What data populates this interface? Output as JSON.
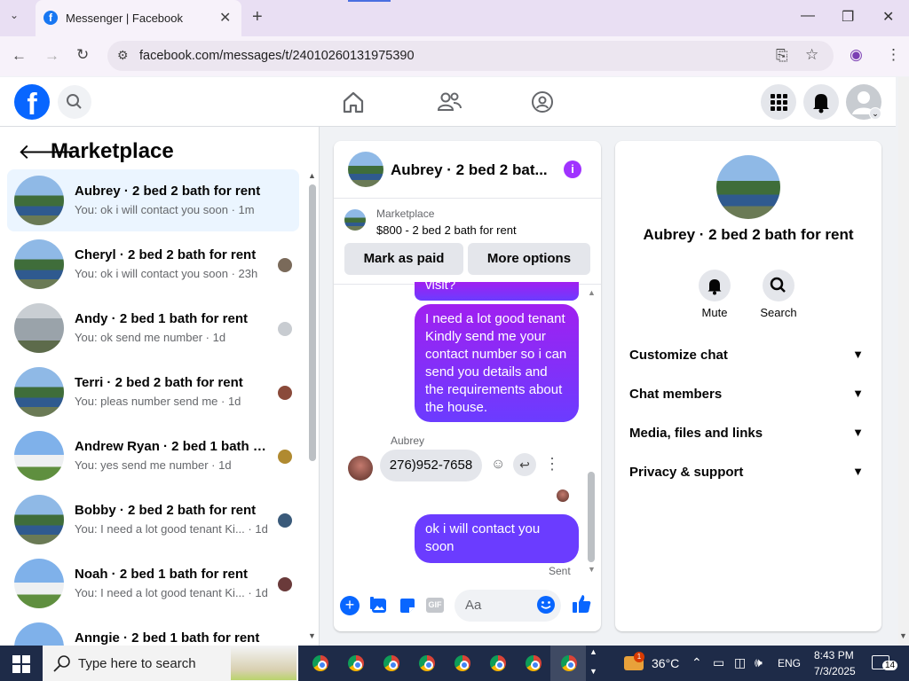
{
  "browser": {
    "tab_title": "Messenger | Facebook",
    "url": "facebook.com/messages/t/24010260131975390"
  },
  "left": {
    "title": "Marketplace",
    "conversations": [
      {
        "name": "Aubrey · 2 bed 2 bath for rent",
        "preview": "You: ok i will contact you soon · 1m"
      },
      {
        "name": "Cheryl · 2 bed 2 bath for rent",
        "preview": "You: ok i will contact you soon · 23h"
      },
      {
        "name": "Andy · 2 bed 1 bath for rent",
        "preview": "You: ok send me number · 1d"
      },
      {
        "name": "Terri · 2 bed 2 bath for rent",
        "preview": "You: pleas number send me · 1d"
      },
      {
        "name": "Andrew Ryan · 2 bed 1 bath fo...",
        "preview": "You: yes send me number · 1d"
      },
      {
        "name": "Bobby · 2 bed 2 bath for rent",
        "preview": "You: I need a lot good tenant Ki...  · 1d"
      },
      {
        "name": "Noah · 2 bed 1 bath for rent",
        "preview": "You: I need a lot good tenant Ki...  · 1d"
      },
      {
        "name": "Anngie · 2 bed 1 bath for rent",
        "preview": ""
      }
    ]
  },
  "chat": {
    "title": "Aubrey · 2 bed 2 bat...",
    "marketplace_label": "Marketplace",
    "listing": "$800 - 2 bed 2 bath for rent",
    "mark_paid": "Mark as paid",
    "more_options": "More options",
    "partial_msg": "visit?",
    "msg1": "I need a lot good tenant Kindly send me your contact number so i can send you details and the requirements about the house.",
    "other_name": "Aubrey",
    "other_msg": "276)952-7658",
    "msg2": "ok i will contact you soon",
    "status": "Sent",
    "composer_placeholder": "Aa"
  },
  "right": {
    "name": "Aubrey · 2 bed 2 bath for rent",
    "mute": "Mute",
    "search": "Search",
    "sections": [
      "Customize chat",
      "Chat members",
      "Media, files and links",
      "Privacy & support"
    ]
  },
  "taskbar": {
    "search_placeholder": "Type here to search",
    "temperature": "36°C",
    "lang": "ENG",
    "time": "8:43 PM",
    "date": "7/3/2025",
    "notifications": "14",
    "weather_badge": "1"
  }
}
